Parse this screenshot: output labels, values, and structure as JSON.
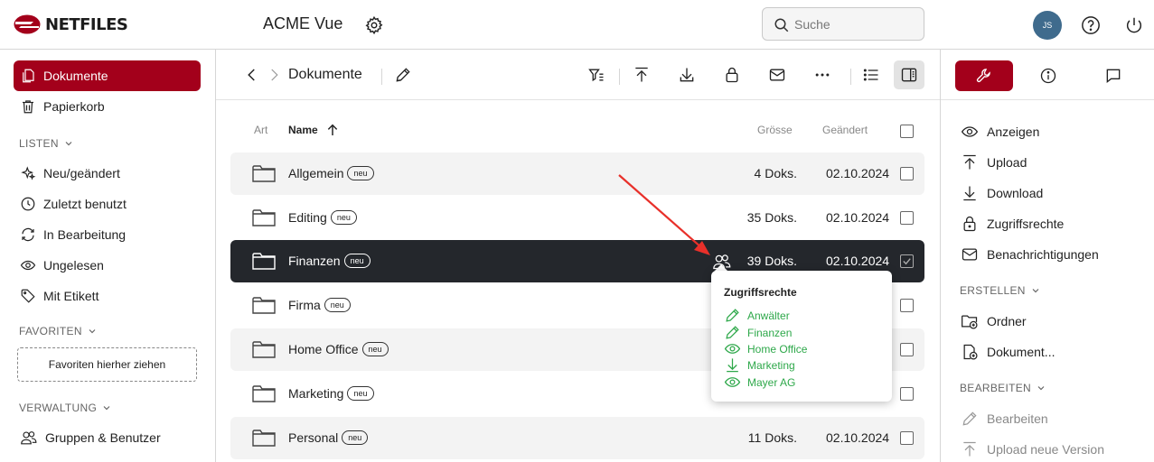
{
  "header": {
    "logo_text": "NETFILES",
    "app_title": "ACME Vue",
    "search_placeholder": "Suche",
    "avatar_initials": "JS"
  },
  "sidebar": {
    "items": [
      {
        "label": "Dokumente",
        "icon": "documents-icon"
      },
      {
        "label": "Papierkorb",
        "icon": "trash-icon"
      }
    ],
    "listen_title": "LISTEN",
    "listen_items": [
      {
        "label": "Neu/geändert",
        "icon": "sparkle-icon"
      },
      {
        "label": "Zuletzt benutzt",
        "icon": "clock-icon"
      },
      {
        "label": "In Bearbeitung",
        "icon": "sync-icon"
      },
      {
        "label": "Ungelesen",
        "icon": "eye-icon"
      },
      {
        "label": "Mit Etikett",
        "icon": "tag-icon"
      }
    ],
    "favoriten_title": "FAVORITEN",
    "favoriten_drop": "Favoriten hierher ziehen",
    "verwaltung_title": "VERWALTUNG",
    "verwaltung_items": [
      {
        "label": "Gruppen & Benutzer",
        "icon": "users-icon"
      }
    ]
  },
  "main": {
    "breadcrumb": "Dokumente",
    "columns": {
      "art": "Art",
      "name": "Name",
      "size": "Grösse",
      "changed": "Geändert"
    },
    "rows": [
      {
        "name": "Allgemein",
        "badge": "neu",
        "size": "4 Doks.",
        "date": "02.10.2024"
      },
      {
        "name": "Editing",
        "badge": "neu",
        "size": "35 Doks.",
        "date": "02.10.2024"
      },
      {
        "name": "Finanzen",
        "badge": "neu",
        "size": "39 Doks.",
        "date": "02.10.2024"
      },
      {
        "name": "Firma",
        "badge": "neu",
        "size": "",
        "date": ""
      },
      {
        "name": "Home Office",
        "badge": "neu",
        "size": "",
        "date": ""
      },
      {
        "name": "Marketing",
        "badge": "neu",
        "size": "",
        "date": ""
      },
      {
        "name": "Personal",
        "badge": "neu",
        "size": "11 Doks.",
        "date": "02.10.2024"
      }
    ],
    "selected_row": "Finanzen"
  },
  "popup": {
    "title": "Zugriffsrechte",
    "entries": [
      {
        "label": "Anwälter",
        "icon": "pencil-icon"
      },
      {
        "label": "Finanzen",
        "icon": "pencil-icon"
      },
      {
        "label": "Home Office",
        "icon": "eye-icon"
      },
      {
        "label": "Marketing",
        "icon": "download-icon"
      },
      {
        "label": "Mayer AG",
        "icon": "eye-icon"
      }
    ],
    "accent_color": "#2ea84a"
  },
  "right_panel": {
    "actions": [
      {
        "label": "Anzeigen",
        "icon": "eye-icon"
      },
      {
        "label": "Upload",
        "icon": "upload-icon"
      },
      {
        "label": "Download",
        "icon": "download-icon"
      },
      {
        "label": "Zugriffsrechte",
        "icon": "lock-icon"
      },
      {
        "label": "Benachrichtigungen",
        "icon": "mail-icon"
      }
    ],
    "erstellen_title": "ERSTELLEN",
    "erstellen_items": [
      {
        "label": "Ordner",
        "icon": "folder-plus-icon"
      },
      {
        "label": "Dokument...",
        "icon": "document-plus-icon"
      }
    ],
    "bearbeiten_title": "BEARBEITEN",
    "bearbeiten_items": [
      {
        "label": "Bearbeiten",
        "icon": "pencil-icon"
      },
      {
        "label": "Upload neue Version",
        "icon": "upload-icon"
      }
    ]
  },
  "colors": {
    "brand": "#a3001b",
    "selected_row": "#24272c",
    "annotation_arrow": "#e8302a"
  }
}
